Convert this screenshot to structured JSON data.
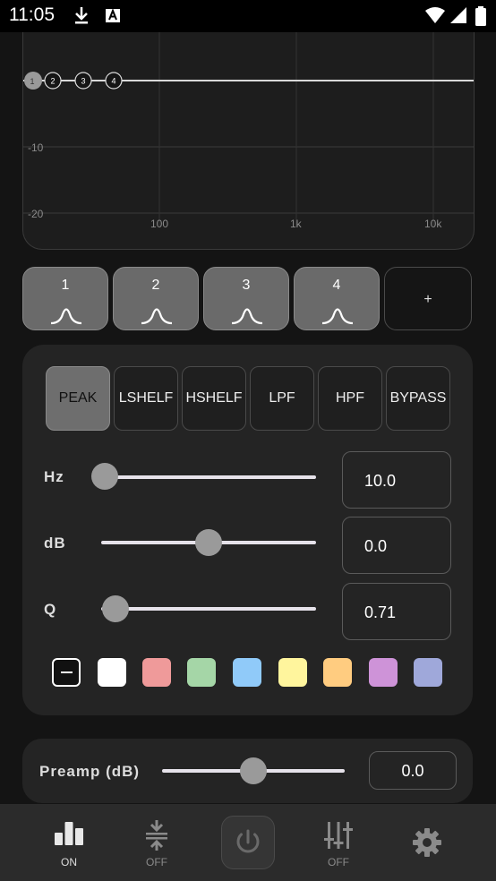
{
  "status_bar": {
    "time": "11:05",
    "icons": [
      "download-icon",
      "font-a-icon",
      "wifi-icon",
      "signal-icon",
      "battery-icon"
    ]
  },
  "graph": {
    "y_ticks": [
      "-10",
      "-20"
    ],
    "x_ticks": [
      "100",
      "1k",
      "10k"
    ],
    "band_markers": [
      "1",
      "2",
      "3",
      "4"
    ]
  },
  "bands": [
    {
      "label": "1",
      "icon": "peak-curve-icon"
    },
    {
      "label": "2",
      "icon": "peak-curve-icon"
    },
    {
      "label": "3",
      "icon": "peak-curve-icon"
    },
    {
      "label": "4",
      "icon": "peak-curve-icon"
    }
  ],
  "add_band_label": "+",
  "filter_types": [
    "PEAK",
    "LSHELF",
    "HSHELF",
    "LPF",
    "HPF",
    "BYPASS"
  ],
  "selected_filter": "PEAK",
  "params": {
    "hz": {
      "label": "Hz",
      "value": "10.0",
      "slider_fraction": 0.0
    },
    "db": {
      "label": "dB",
      "value": "0.0",
      "slider_fraction": 0.5
    },
    "q": {
      "label": "Q",
      "value": "0.71",
      "slider_fraction": 0.05
    }
  },
  "colors": [
    "none",
    "#ffffff",
    "#ef9a9a",
    "#a5d6a7",
    "#90caf9",
    "#fff59d",
    "#ffcc80",
    "#ce93d8",
    "#9fa8da"
  ],
  "preamp": {
    "label": "Preamp (dB)",
    "value": "0.0",
    "slider_fraction": 0.5
  },
  "nav": [
    {
      "icon": "bar-chart-icon",
      "label": "ON"
    },
    {
      "icon": "compress-icon",
      "label": "OFF"
    },
    {
      "icon": "power-icon",
      "label": ""
    },
    {
      "icon": "equalizer-sliders-icon",
      "label": "OFF"
    },
    {
      "icon": "gear-icon",
      "label": ""
    }
  ]
}
